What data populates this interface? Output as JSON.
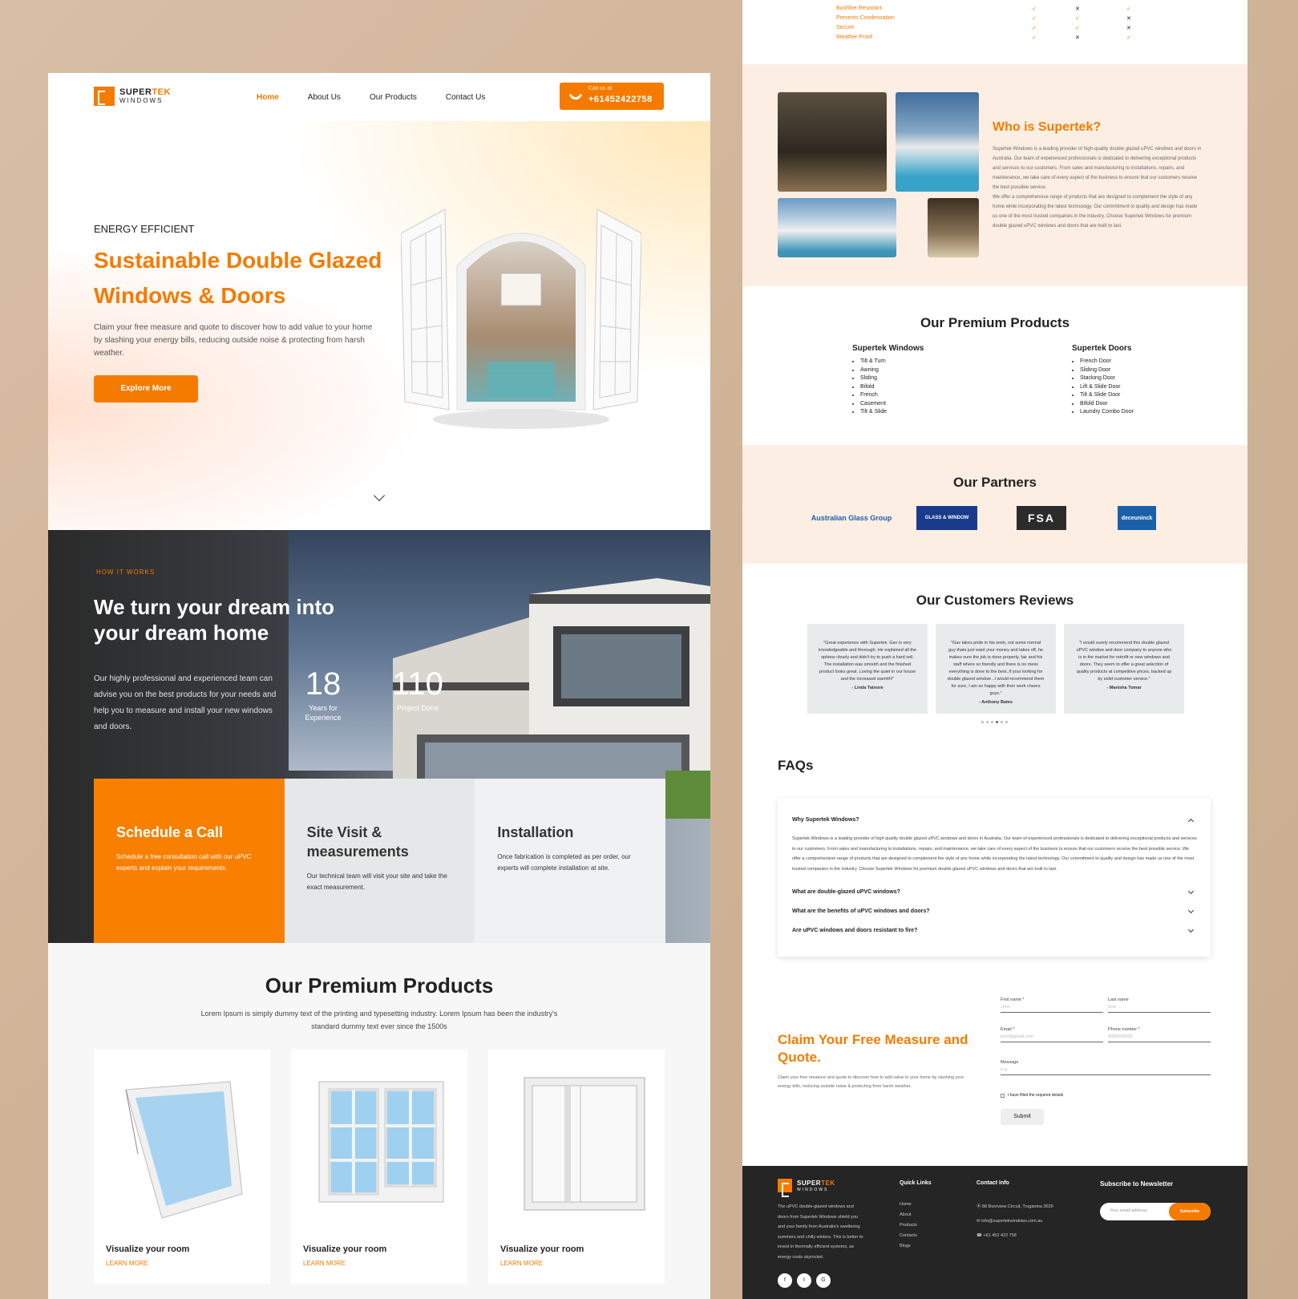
{
  "nav": {
    "logo_a": "SUPER",
    "logo_b": "TEK",
    "logo_sub": "WINDOWS",
    "items": [
      "Home",
      "About Us",
      "Our Products",
      "Contact Us"
    ],
    "call_small": "Call us at",
    "call_number": "+61452422758"
  },
  "hero": {
    "eyebrow": "ENERGY EFFICIENT",
    "title": "Sustainable Double Glazed Windows & Doors",
    "text": "Claim your free measure and quote to discover how to add value to your home by slashing your energy bills, reducing outside noise & protecting from harsh weather.",
    "button": "Explore More"
  },
  "how": {
    "tag": "HOW IT WORKS",
    "title": "We turn your dream into your dream home",
    "text": "Our highly professional and experienced team can advise you on the best products for your needs and help you to measure and install your new windows and doors.",
    "stats": [
      {
        "value": "18",
        "label": "Years for Experience"
      },
      {
        "value": "110",
        "label": "Project Done"
      }
    ]
  },
  "steps": [
    {
      "title": "Schedule a Call",
      "text": "Schedule a free consultation call with our uPVC experts and explain your requirements."
    },
    {
      "title": "Site Visit & measurements",
      "text": "Our technical team will visit your site and take the exact measurement."
    },
    {
      "title": "Installation",
      "text": "Once fabrication is completed as per order, our experts will complete installation at site."
    }
  ],
  "products": {
    "title": "Our Premium Products",
    "sub": "Lorem Ipsum is simply dummy text of the printing and typesetting industry. Lorem Ipsum has been the industry's standard dummy text ever since the 1500s",
    "cards": [
      {
        "title": "Visualize your room",
        "link": "LEARN MORE"
      },
      {
        "title": "Visualize your room",
        "link": "LEARN MORE"
      },
      {
        "title": "Visualize your room",
        "link": "LEARN MORE"
      }
    ]
  },
  "compare": [
    {
      "label": "Bushfire Resistant",
      "a": "✓",
      "b": "✕",
      "c": "✓"
    },
    {
      "label": "Prevents Condensation",
      "a": "✓",
      "b": "✓",
      "c": "✕"
    },
    {
      "label": "Secure",
      "a": "✓",
      "b": "✓",
      "c": "✕"
    },
    {
      "label": "Weather Proof",
      "a": "✓",
      "b": "✕",
      "c": "✓"
    }
  ],
  "who": {
    "title": "Who is Supertek?",
    "p1": "Supertek Windows is a leading provider of high-quality double glazed uPVC windows and doors in Australia. Our team of experienced professionals is dedicated to delivering exceptional products and services to our customers. From sales and manufacturing to installations, repairs, and maintenance, we take care of every aspect of the business to ensure that our customers receive the best possible service.",
    "p2": "We offer a comprehensive range of products that are designed to complement the style of any home while incorporating the latest technology. Our commitment to quality and design has made us one of the most trusted companies in the industry. Choose Supertek Windows for premium double glazed uPVC windows and doors that are built to last."
  },
  "premium": {
    "title": "Our Premium Products",
    "windows_title": "Supertek Windows",
    "windows": [
      "Tilt & Turn",
      "Awning",
      "Sliding",
      "Bifold",
      "French",
      "Casement",
      "Tilt & Slide"
    ],
    "doors_title": "Supertek Doors",
    "doors": [
      "French Door",
      "Sliding Door",
      "Stacking Door",
      "Lift & Slide Door",
      "Tilt & Slide Door",
      "Bifold Door",
      "Laundry Combo Door"
    ]
  },
  "partners": {
    "title": "Our Partners",
    "names": [
      "Australian Glass Group",
      "GLASS & WINDOW",
      "FSA",
      "deceuninck"
    ]
  },
  "reviews": {
    "title": "Our Customers Reviews",
    "items": [
      {
        "text": "\"Great experience with Supertek. Gav is very knowledgeable and thorough. He explained all the options clearly and didn't try to push a hard sell. The installation was smooth and the finished product looks great. Loving the quiet in our house and the increased warmth!\"",
        "author": "- Linda Tatnore"
      },
      {
        "text": "\"Gav takes pride in his work, not some normal guy thats just want your money and takes off, he makes sure the job is done properly, fair and his staff where so friendly and there is no mess everything is done to the best..if your looking for double glazed window ..I would recommend them for sure, I am so happy with their work cheers guys.\"",
        "author": "- Anthony Bates"
      },
      {
        "text": "\"I would surely recommend this double glazed uPVC window and door company to anyone who is in the market for retrofit or new windows and doors. They seem to offer a great selection of quality products at competitive prices, backed up by solid customer service.\"",
        "author": "- Manisha Tomar"
      }
    ]
  },
  "faq": {
    "title": "FAQs",
    "items": [
      "Why Supertek Windows?",
      "What are double-glazed uPVC windows?",
      "What are the benefits of uPVC windows and doors?",
      "Are uPVC windows and doors resistant to fire?"
    ],
    "answer": "Supertek Windows is a leading provider of high quality double glazed uPVC windows and doors in Australia. Our team of experienced professionals is dedicated to delivering exceptional products and services to our customers. From sales and manufacturing to installations, repairs, and maintenance, we take care of every aspect of the business to ensure that our customers receive the best possible service. We offer a comprehensive range of products that are designed to complement the style of any home while incorporating the latest technology. Our commitment to quality and design has made us one of the most trusted companies in the industry. Choose Supertek Windows for premium double glazed uPVC windows and doors that are built to last."
  },
  "claim": {
    "title": "Claim Your Free Measure and Quote.",
    "text": "Claim your free measure and quote to discover how to add value to your home by slashing your energy bills, reducing outside noise & protecting from harsh weather.",
    "first": "First name *",
    "first_ph": "John",
    "last": "Last name",
    "last_ph": "Doe",
    "email": "Email *",
    "email_ph": "john@gmail.com",
    "phone": "Phone number *",
    "phone_ph": "0000000000",
    "msg": "Message",
    "msg_ph": "e.g.",
    "check": "I have filled the required details",
    "submit": "Submit"
  },
  "footer": {
    "desc": "The uPVC double-glazed windows and doors from Supertek Windows shield you and your family from Australia's sweltering summers and chilly winters. This is better to invest in thermally efficient systems, as energy costs skyrocket.",
    "ql": "Quick Links",
    "links": [
      "Home",
      "About",
      "Products",
      "Contacts",
      "Blogs"
    ],
    "ci": "Contact Info",
    "contacts": [
      "88 Burnview Circuit, Truganina 3029",
      "info@supertekwindows.com.au",
      "+61 452 422 758"
    ],
    "news": "Subscribe to Newsletter",
    "news_ph": "Your email address",
    "news_btn": "Subscribe",
    "social": [
      "f",
      "t",
      "G"
    ]
  }
}
